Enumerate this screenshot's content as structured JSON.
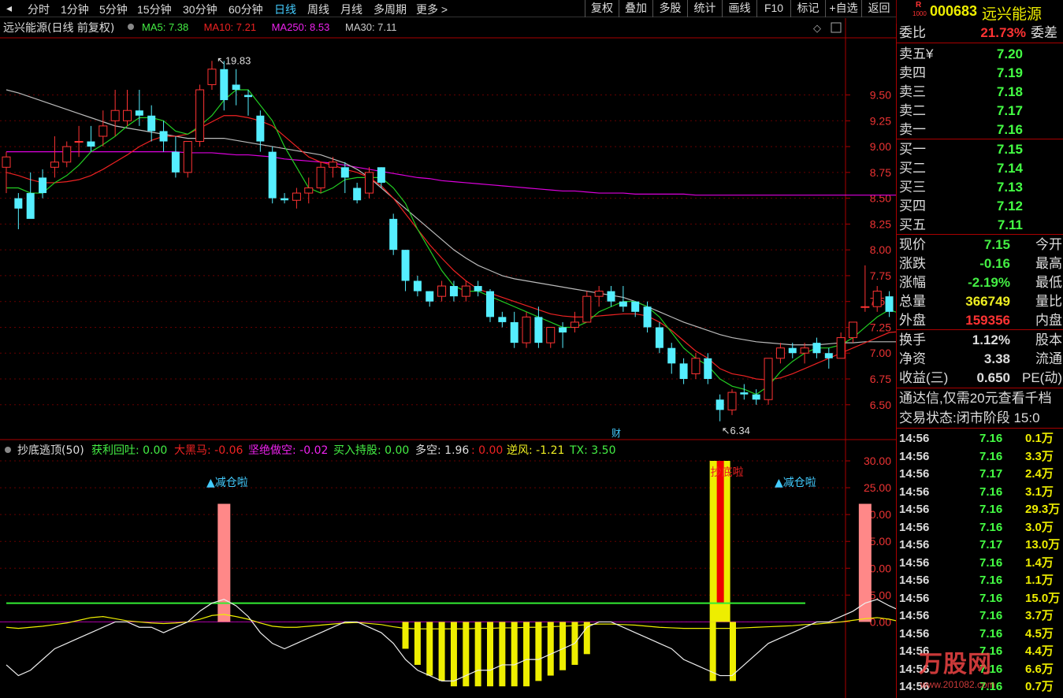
{
  "toolbar": {
    "left_tabs": [
      "分时",
      "1分钟",
      "5分钟",
      "15分钟",
      "30分钟",
      "60分钟",
      "日线",
      "周线",
      "月线",
      "多周期",
      "更多 >"
    ],
    "active_tab": "日线",
    "right_buttons": [
      "复权",
      "叠加",
      "多股",
      "统计",
      "画线",
      "F10",
      "标记",
      "+自选",
      "返回"
    ]
  },
  "stock": {
    "code": "000683",
    "name": "远兴能源",
    "badge": "R",
    "badge_sub": "1000"
  },
  "main_chart": {
    "title": "远兴能源(日线 前复权)",
    "ma_labels": [
      {
        "text": "MA5: 7.38",
        "color": "#44ee44"
      },
      {
        "text": "MA10: 7.21",
        "color": "#ee2222"
      },
      {
        "text": "MA250: 8.53",
        "color": "#ee22ee"
      },
      {
        "text": "MA30: 7.11",
        "color": "#cccccc"
      }
    ],
    "high_label": "19.83",
    "low_label": "6.34",
    "finance_marker": "财",
    "y_ticks": [
      "9.50",
      "9.25",
      "9.00",
      "8.75",
      "8.50",
      "8.25",
      "8.00",
      "7.75",
      "7.50",
      "7.25",
      "7.00",
      "6.75",
      "6.50"
    ],
    "y_tick_values": [
      9.5,
      9.25,
      9.0,
      8.75,
      8.5,
      8.25,
      8.0,
      7.75,
      7.5,
      7.25,
      7.0,
      6.75,
      6.5
    ],
    "y_range": [
      6.3,
      10.0
    ]
  },
  "chart_data": {
    "type": "candlestick",
    "title": "远兴能源(日线 前复权)",
    "candles": [
      [
        8.8,
        8.95,
        8.9,
        8.55
      ],
      [
        8.5,
        8.55,
        8.4,
        8.2
      ],
      [
        8.55,
        8.75,
        8.3,
        8.4
      ],
      [
        8.7,
        8.78,
        8.55,
        8.5
      ],
      [
        8.8,
        9.1,
        8.85,
        8.7
      ],
      [
        8.85,
        9.05,
        9.0,
        8.8
      ],
      [
        9.05,
        9.2,
        9.05,
        8.9
      ],
      [
        9.05,
        9.2,
        9.0,
        8.95
      ],
      [
        9.1,
        9.35,
        9.2,
        9.0
      ],
      [
        9.25,
        9.55,
        9.35,
        9.1
      ],
      [
        9.25,
        9.55,
        9.35,
        9.2
      ],
      [
        9.35,
        9.55,
        9.3,
        9.2
      ],
      [
        9.3,
        9.4,
        9.15,
        9.05
      ],
      [
        9.15,
        9.25,
        9.05,
        8.95
      ],
      [
        8.95,
        9.1,
        8.75,
        8.7
      ],
      [
        8.75,
        9.05,
        9.05,
        8.7
      ],
      [
        9.05,
        9.6,
        9.55,
        9.0
      ],
      [
        9.6,
        9.83,
        9.75,
        9.55
      ],
      [
        9.75,
        9.83,
        9.45,
        9.35
      ],
      [
        9.6,
        9.75,
        9.55,
        9.4
      ],
      [
        9.5,
        9.55,
        9.48,
        9.3
      ],
      [
        9.3,
        9.35,
        9.05,
        8.95
      ],
      [
        8.95,
        9.0,
        8.5,
        8.45
      ],
      [
        8.5,
        8.55,
        8.48,
        8.45
      ],
      [
        8.48,
        8.6,
        8.55,
        8.4
      ],
      [
        8.55,
        8.7,
        8.6,
        8.45
      ],
      [
        8.6,
        8.85,
        8.8,
        8.55
      ],
      [
        8.8,
        8.9,
        8.85,
        8.7
      ],
      [
        8.8,
        8.85,
        8.7,
        8.55
      ],
      [
        8.6,
        8.65,
        8.48,
        8.45
      ],
      [
        8.55,
        8.8,
        8.75,
        8.5
      ],
      [
        8.8,
        8.8,
        8.65,
        8.6
      ],
      [
        8.3,
        8.35,
        8.0,
        7.95
      ],
      [
        8.0,
        8.0,
        7.7,
        7.6
      ],
      [
        7.7,
        7.75,
        7.6,
        7.55
      ],
      [
        7.6,
        7.6,
        7.5,
        7.45
      ],
      [
        7.55,
        7.7,
        7.65,
        7.5
      ],
      [
        7.65,
        7.7,
        7.55,
        7.5
      ],
      [
        7.55,
        7.7,
        7.65,
        7.5
      ],
      [
        7.65,
        7.7,
        7.6,
        7.55
      ],
      [
        7.6,
        7.62,
        7.35,
        7.3
      ],
      [
        7.35,
        7.4,
        7.3,
        7.25
      ],
      [
        7.3,
        7.4,
        7.1,
        7.05
      ],
      [
        7.1,
        7.4,
        7.35,
        7.05
      ],
      [
        7.35,
        7.45,
        7.1,
        7.05
      ],
      [
        7.1,
        7.25,
        7.25,
        7.05
      ],
      [
        7.25,
        7.3,
        7.2,
        7.05
      ],
      [
        7.25,
        7.4,
        7.3,
        7.2
      ],
      [
        7.3,
        7.6,
        7.55,
        7.3
      ],
      [
        7.55,
        7.65,
        7.6,
        7.45
      ],
      [
        7.6,
        7.65,
        7.5,
        7.45
      ],
      [
        7.5,
        7.65,
        7.45,
        7.4
      ],
      [
        7.5,
        7.5,
        7.4,
        7.35
      ],
      [
        7.45,
        7.5,
        7.25,
        7.2
      ],
      [
        7.25,
        7.3,
        7.05,
        7.0
      ],
      [
        7.05,
        7.1,
        6.9,
        6.8
      ],
      [
        6.9,
        6.95,
        6.75,
        6.7
      ],
      [
        6.8,
        7.0,
        6.95,
        6.75
      ],
      [
        6.95,
        7.0,
        6.75,
        6.7
      ],
      [
        6.55,
        6.6,
        6.45,
        6.34
      ],
      [
        6.45,
        6.65,
        6.62,
        6.4
      ],
      [
        6.62,
        6.7,
        6.6,
        6.55
      ],
      [
        6.6,
        6.65,
        6.55,
        6.5
      ],
      [
        6.55,
        6.95,
        6.95,
        6.5
      ],
      [
        6.95,
        7.1,
        7.05,
        6.9
      ],
      [
        7.05,
        7.1,
        7.0,
        6.95
      ],
      [
        7.0,
        7.1,
        7.05,
        6.9
      ],
      [
        7.1,
        7.15,
        7.0,
        6.95
      ],
      [
        7.0,
        7.05,
        6.95,
        6.85
      ],
      [
        6.95,
        7.2,
        7.15,
        6.95
      ],
      [
        7.15,
        7.3,
        7.3,
        7.1
      ],
      [
        7.45,
        7.85,
        7.45,
        7.4
      ],
      [
        7.45,
        7.65,
        7.6,
        7.4
      ],
      [
        7.55,
        7.6,
        7.4,
        7.35
      ],
      [
        7.4,
        7.42,
        7.3,
        7.25
      ],
      [
        7.3,
        7.3,
        7.15,
        7.12
      ]
    ],
    "candle_note": "each candle: [open, high, close, low] in price units",
    "ma5": [
      8.6,
      8.6,
      8.55,
      8.55,
      8.65,
      8.72,
      8.82,
      8.95,
      9.02,
      9.1,
      9.2,
      9.28,
      9.28,
      9.25,
      9.15,
      9.12,
      9.2,
      9.3,
      9.45,
      9.55,
      9.55,
      9.4,
      9.25,
      9.0,
      8.8,
      8.6,
      8.55,
      8.6,
      8.68,
      8.7,
      8.7,
      8.7,
      8.6,
      8.45,
      8.2,
      8.0,
      7.8,
      7.65,
      7.6,
      7.6,
      7.55,
      7.5,
      7.45,
      7.4,
      7.35,
      7.3,
      7.25,
      7.25,
      7.3,
      7.4,
      7.45,
      7.5,
      7.5,
      7.45,
      7.35,
      7.2,
      7.05,
      6.95,
      6.88,
      6.75,
      6.68,
      6.65,
      6.6,
      6.68,
      6.82,
      6.92,
      7.0,
      7.05,
      7.05,
      7.08,
      7.15,
      7.25,
      7.35,
      7.42,
      7.38,
      7.33
    ],
    "ma10": [
      8.75,
      8.72,
      8.68,
      8.65,
      8.65,
      8.66,
      8.68,
      8.72,
      8.78,
      8.85,
      8.92,
      9.0,
      9.06,
      9.1,
      9.1,
      9.12,
      9.18,
      9.24,
      9.3,
      9.3,
      9.28,
      9.25,
      9.2,
      9.1,
      9.0,
      8.9,
      8.85,
      8.82,
      8.78,
      8.75,
      8.7,
      8.62,
      8.5,
      8.35,
      8.2,
      8.05,
      7.92,
      7.8,
      7.7,
      7.62,
      7.58,
      7.54,
      7.5,
      7.46,
      7.42,
      7.38,
      7.36,
      7.35,
      7.35,
      7.36,
      7.37,
      7.38,
      7.38,
      7.36,
      7.3,
      7.22,
      7.12,
      7.02,
      6.95,
      6.85,
      6.8,
      6.78,
      6.75,
      6.74,
      6.76,
      6.8,
      6.85,
      6.9,
      6.95,
      7.0,
      7.05,
      7.1,
      7.15,
      7.2,
      7.21,
      7.21
    ],
    "ma30": [
      9.55,
      9.52,
      9.48,
      9.44,
      9.4,
      9.36,
      9.32,
      9.28,
      9.24,
      9.2,
      9.18,
      9.16,
      9.14,
      9.12,
      9.1,
      9.08,
      9.08,
      9.08,
      9.08,
      9.06,
      9.04,
      9.02,
      9.0,
      8.98,
      8.96,
      8.94,
      8.92,
      8.88,
      8.84,
      8.78,
      8.7,
      8.6,
      8.5,
      8.4,
      8.3,
      8.2,
      8.1,
      8.0,
      7.92,
      7.85,
      7.8,
      7.75,
      7.72,
      7.7,
      7.68,
      7.66,
      7.64,
      7.62,
      7.6,
      7.58,
      7.56,
      7.54,
      7.5,
      7.45,
      7.4,
      7.35,
      7.3,
      7.26,
      7.22,
      7.18,
      7.15,
      7.13,
      7.11,
      7.1,
      7.09,
      7.08,
      7.08,
      7.08,
      7.09,
      7.1,
      7.1,
      7.11,
      7.11,
      7.11,
      7.11,
      7.11
    ],
    "ma250": [
      8.95,
      8.95,
      8.95,
      8.95,
      8.95,
      8.95,
      8.95,
      8.95,
      8.95,
      8.95,
      8.95,
      8.95,
      8.95,
      8.95,
      8.95,
      8.94,
      8.94,
      8.94,
      8.93,
      8.92,
      8.92,
      8.91,
      8.9,
      8.88,
      8.87,
      8.86,
      8.85,
      8.84,
      8.82,
      8.8,
      8.78,
      8.76,
      8.74,
      8.72,
      8.7,
      8.69,
      8.67,
      8.66,
      8.65,
      8.64,
      8.63,
      8.62,
      8.61,
      8.6,
      8.59,
      8.58,
      8.57,
      8.57,
      8.56,
      8.55,
      8.55,
      8.55,
      8.54,
      8.54,
      8.54,
      8.54,
      8.54,
      8.53,
      8.53,
      8.53,
      8.53,
      8.53,
      8.53,
      8.53,
      8.53,
      8.53,
      8.53,
      8.53,
      8.53,
      8.53,
      8.53,
      8.53,
      8.53,
      8.53,
      8.53,
      8.53
    ],
    "indicator": {
      "y_ticks": [
        "30.00",
        "25.00",
        "20.00",
        "15.00",
        "10.00",
        "5.00",
        "0.00"
      ],
      "y_tick_values": [
        30,
        25,
        20,
        15,
        10,
        5,
        0
      ],
      "y_range": [
        -13,
        30
      ],
      "green_level": 3.5,
      "white": [
        -8,
        -10,
        -9,
        -7,
        -5,
        -4,
        -3,
        -2,
        -1,
        0,
        0,
        -1,
        -1,
        -2,
        -1,
        0,
        2,
        3.5,
        4.2,
        3,
        1,
        -2,
        -4,
        -5,
        -4,
        -3,
        -2,
        -1,
        0,
        0,
        -1,
        -2,
        -4,
        -7,
        -9,
        -10,
        -11,
        -11,
        -10,
        -9,
        -9,
        -8,
        -8,
        -7,
        -7,
        -6,
        -5,
        -4,
        -1,
        0,
        0,
        -1,
        -2,
        -3,
        -4,
        -5,
        -7,
        -8,
        -9,
        -10,
        -10,
        -8,
        -6,
        -4,
        -3,
        -2,
        -1,
        0,
        0,
        1,
        2,
        3.5,
        4.2,
        3,
        2,
        1
      ],
      "yellow": [
        -1,
        -1.2,
        -1,
        -0.8,
        -0.5,
        -0.2,
        0.3,
        0.8,
        1,
        0.6,
        0.2,
        0,
        -0.2,
        -0.3,
        -0.2,
        0,
        0.5,
        1.2,
        1.4,
        1,
        0.5,
        -0.2,
        -0.8,
        -1,
        -1,
        -0.8,
        -0.6,
        -0.4,
        -0.2,
        -0.1,
        -0.3,
        -0.5,
        -0.9,
        -1.2,
        -1.3,
        -1.3,
        -1.3,
        -1.3,
        -1.3,
        -1.2,
        -1.2,
        -1.1,
        -1.1,
        -1,
        -1,
        -0.9,
        -0.8,
        -0.7,
        -0.5,
        -0.4,
        -0.4,
        -0.5,
        -0.6,
        -0.8,
        -1,
        -1.1,
        -1.2,
        -1.2,
        -1.2,
        -1.2,
        -1.2,
        -1.1,
        -1,
        -0.9,
        -0.8,
        -0.7,
        -0.5,
        -0.4,
        -0.2,
        0,
        0.3,
        0.6,
        0.8,
        0.5,
        0,
        -1.2
      ],
      "yellow_bars_neg": [
        33,
        34,
        35,
        36,
        37,
        38,
        39,
        40,
        41,
        42,
        43,
        44,
        45,
        46,
        47,
        48
      ],
      "yellow_bars_neg_depth": [
        -5,
        -8,
        -10,
        -11,
        -12,
        -12,
        -12,
        -12,
        -12,
        -12,
        -12,
        -11,
        -10,
        -9,
        -8,
        -6
      ],
      "pink_bars": [
        {
          "i": 18,
          "v": 22
        },
        {
          "i": 71,
          "v": 22
        }
      ],
      "pink_labels": [
        "▲减仓啦",
        "▲减仓啦"
      ],
      "red_bar": {
        "i": 59,
        "v": 30
      },
      "red_label": "抄底啦",
      "red_bar_yellow_neg": [
        59,
        60
      ]
    }
  },
  "indicator_header": {
    "title": "抄底逃顶(50)",
    "items": [
      {
        "text": "获利回吐: 0.00",
        "color": "#44ee44"
      },
      {
        "text": "大黑马: -0.06",
        "color": "#ee2222"
      },
      {
        "text": "坚绝做空: -0.02",
        "color": "#ee22ee"
      },
      {
        "text": "买入持股: 0.00",
        "color": "#44ee44"
      },
      {
        "text": "多空: 1.96",
        "color": "#dddddd"
      },
      {
        "text": ": 0.00",
        "color": "#ee2222"
      },
      {
        "text": "逆风: -1.21",
        "color": "#eeee22"
      },
      {
        "text": "TX: 3.50",
        "color": "#44ee44"
      }
    ]
  },
  "quote": {
    "weibi_label": "委比",
    "weibi_value": "21.73%",
    "weicha_label": "委差",
    "sell": [
      {
        "label": "卖五",
        "price": "7.20",
        "extra": "¥"
      },
      {
        "label": "卖四",
        "price": "7.19"
      },
      {
        "label": "卖三",
        "price": "7.18"
      },
      {
        "label": "卖二",
        "price": "7.17"
      },
      {
        "label": "卖一",
        "price": "7.16"
      }
    ],
    "buy": [
      {
        "label": "买一",
        "price": "7.15"
      },
      {
        "label": "买二",
        "price": "7.14"
      },
      {
        "label": "买三",
        "price": "7.13"
      },
      {
        "label": "买四",
        "price": "7.12"
      },
      {
        "label": "买五",
        "price": "7.11"
      }
    ],
    "stats": [
      {
        "label": "现价",
        "value": "7.15",
        "color": "#44ee44",
        "right": "今开"
      },
      {
        "label": "涨跌",
        "value": "-0.16",
        "color": "#44ee44",
        "right": "最高"
      },
      {
        "label": "涨幅",
        "value": "-2.19%",
        "color": "#44ee44",
        "right": "最低"
      },
      {
        "label": "总量",
        "value": "366749",
        "color": "#eeee22",
        "right": "量比"
      },
      {
        "label": "外盘",
        "value": "159356",
        "color": "#ff3333",
        "right": "内盘"
      }
    ],
    "stats2": [
      {
        "label": "换手",
        "value": "1.12%",
        "right": "股本"
      },
      {
        "label": "净资",
        "value": "3.38",
        "right": "流通"
      },
      {
        "label": "收益(三)",
        "value": "0.650",
        "right": "PE(动)"
      }
    ],
    "promo": "通达信,仅需20元查看千档",
    "trade_status_label": "交易状态:",
    "trade_status": "闭市阶段",
    "trade_time": "15:0",
    "ticks": [
      {
        "t": "14:56",
        "p": "7.16",
        "v": "0.1万"
      },
      {
        "t": "14:56",
        "p": "7.16",
        "v": "3.3万"
      },
      {
        "t": "14:56",
        "p": "7.17",
        "v": "2.4万"
      },
      {
        "t": "14:56",
        "p": "7.16",
        "v": "3.1万"
      },
      {
        "t": "14:56",
        "p": "7.16",
        "v": "29.3万"
      },
      {
        "t": "14:56",
        "p": "7.16",
        "v": "3.0万"
      },
      {
        "t": "14:56",
        "p": "7.17",
        "v": "13.0万"
      },
      {
        "t": "14:56",
        "p": "7.16",
        "v": "1.4万"
      },
      {
        "t": "14:56",
        "p": "7.16",
        "v": "1.1万"
      },
      {
        "t": "14:56",
        "p": "7.16",
        "v": "15.0万"
      },
      {
        "t": "14:56",
        "p": "7.16",
        "v": "3.7万"
      },
      {
        "t": "14:56",
        "p": "7.16",
        "v": "4.5万"
      },
      {
        "t": "14:56",
        "p": "7.16",
        "v": "4.4万"
      },
      {
        "t": "14:56",
        "p": "7.16",
        "v": "6.6万"
      },
      {
        "t": "14:56",
        "p": "7.16",
        "v": "0.7万"
      }
    ],
    "watermark": "万股网",
    "watermark_url": "www.201082.com"
  }
}
